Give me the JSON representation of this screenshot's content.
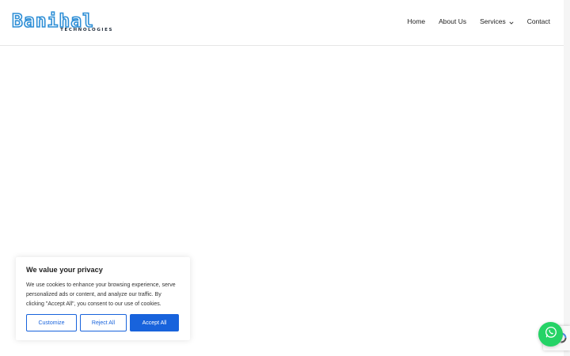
{
  "brand": {
    "logo_word": "Banihal",
    "logo_sub": "TECHNOLOGIES",
    "accent": "#2f8fd6"
  },
  "nav": {
    "items": [
      {
        "label": "Home",
        "has_dropdown": false
      },
      {
        "label": "About Us",
        "has_dropdown": false
      },
      {
        "label": "Services",
        "has_dropdown": true,
        "icon": "chevron-down-icon"
      },
      {
        "label": "Contact",
        "has_dropdown": false
      }
    ]
  },
  "cookie_banner": {
    "title": "We value your privacy",
    "text": "We use cookies to enhance your browsing experience, serve personalized ads or content, and analyze our traffic. By clicking \"Accept All\", you consent to our use of cookies.",
    "buttons": {
      "customize": "Customize",
      "reject": "Reject All",
      "accept": "Accept All"
    },
    "accent": "#1863dc"
  },
  "floating": {
    "whatsapp_icon": "whatsapp-icon",
    "whatsapp_color": "#25d366",
    "recaptcha_icon": "recaptcha-icon"
  }
}
